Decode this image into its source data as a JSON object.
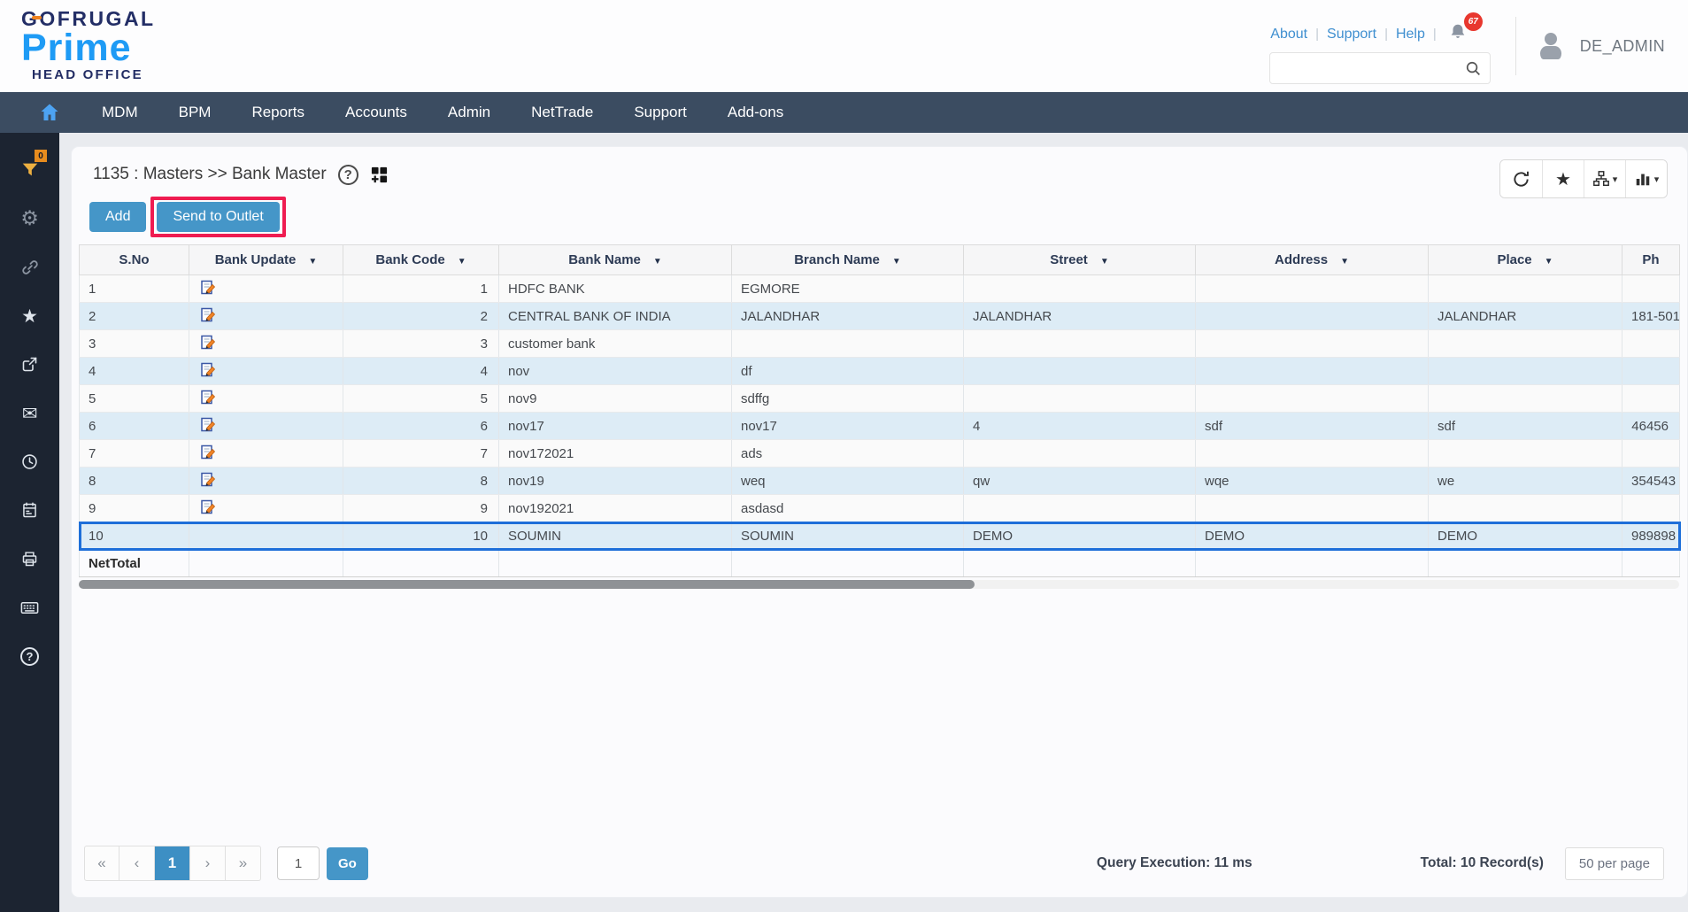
{
  "colors": {
    "accent": "#4596c8",
    "annotation_highlight": "#ef1c51",
    "selected_row_border": "#1e6fd9",
    "navbar_bg": "#3b4c61",
    "sidebar_bg": "#1c2431",
    "row_alt_bg": "#ddecf6",
    "badge_red": "#e8372e"
  },
  "header": {
    "logo": {
      "brand": "GOFRUGAL",
      "product": "Prime",
      "suffix": "HEAD OFFICE"
    },
    "links": [
      "About",
      "Support",
      "Help"
    ],
    "notification_count": "67",
    "search_placeholder": "",
    "user": "DE_ADMIN"
  },
  "navbar": {
    "items": [
      "MDM",
      "BPM",
      "Reports",
      "Accounts",
      "Admin",
      "NetTrade",
      "Support",
      "Add-ons"
    ]
  },
  "sidebar": {
    "filter_badge": "0",
    "icons": [
      "filter-icon",
      "gear-icon",
      "link-icon",
      "star-icon",
      "share-icon",
      "mail-icon",
      "clock-icon",
      "report-icon",
      "print-icon",
      "keyboard-icon",
      "help-icon"
    ]
  },
  "page": {
    "breadcrumb": "1135 : Masters >> Bank Master",
    "add_label": "Add",
    "send_to_outlet_label": "Send to Outlet"
  },
  "table": {
    "columns": [
      {
        "label": "S.No",
        "sortable": false
      },
      {
        "label": "Bank Update",
        "sortable": true
      },
      {
        "label": "Bank Code",
        "sortable": true
      },
      {
        "label": "Bank Name",
        "sortable": true
      },
      {
        "label": "Branch Name",
        "sortable": true
      },
      {
        "label": "Street",
        "sortable": true
      },
      {
        "label": "Address",
        "sortable": true
      },
      {
        "label": "Place",
        "sortable": true
      },
      {
        "label": "Ph",
        "sortable": false
      }
    ],
    "rows": [
      {
        "sno": "1",
        "edit": true,
        "code": "1",
        "name": "HDFC BANK",
        "branch": "EGMORE",
        "street": "",
        "address": "",
        "place": "",
        "phone": "",
        "selected": false
      },
      {
        "sno": "2",
        "edit": true,
        "code": "2",
        "name": "CENTRAL BANK OF INDIA",
        "branch": "JALANDHAR",
        "street": "JALANDHAR",
        "address": "",
        "place": "JALANDHAR",
        "phone": "181-501",
        "selected": false
      },
      {
        "sno": "3",
        "edit": true,
        "code": "3",
        "name": "customer bank",
        "branch": "",
        "street": "",
        "address": "",
        "place": "",
        "phone": "",
        "selected": false
      },
      {
        "sno": "4",
        "edit": true,
        "code": "4",
        "name": "nov",
        "branch": "df",
        "street": "",
        "address": "",
        "place": "",
        "phone": "",
        "selected": false
      },
      {
        "sno": "5",
        "edit": true,
        "code": "5",
        "name": "nov9",
        "branch": "sdffg",
        "street": "",
        "address": "",
        "place": "",
        "phone": "",
        "selected": false
      },
      {
        "sno": "6",
        "edit": true,
        "code": "6",
        "name": "nov17",
        "branch": "nov17",
        "street": "4",
        "address": "sdf",
        "place": "sdf",
        "phone": "46456",
        "selected": false
      },
      {
        "sno": "7",
        "edit": true,
        "code": "7",
        "name": "nov172021",
        "branch": "ads",
        "street": "",
        "address": "",
        "place": "",
        "phone": "",
        "selected": false
      },
      {
        "sno": "8",
        "edit": true,
        "code": "8",
        "name": "nov19",
        "branch": "weq",
        "street": "qw",
        "address": "wqe",
        "place": "we",
        "phone": "354543",
        "selected": false
      },
      {
        "sno": "9",
        "edit": true,
        "code": "9",
        "name": "nov192021",
        "branch": "asdasd",
        "street": "",
        "address": "",
        "place": "",
        "phone": "",
        "selected": false
      },
      {
        "sno": "10",
        "edit": false,
        "code": "10",
        "name": "SOUMIN",
        "branch": "SOUMIN",
        "street": "DEMO",
        "address": "DEMO",
        "place": "DEMO",
        "phone": "989898",
        "selected": true
      }
    ],
    "net_total_label": "NetTotal"
  },
  "pagination": {
    "first": "«",
    "prev": "‹",
    "current_page": "1",
    "next": "›",
    "last": "»",
    "goto_value": "1",
    "go_label": "Go"
  },
  "footer": {
    "query_execution": "Query Execution: 11 ms",
    "total": "Total: 10 Record(s)",
    "per_page": "50 per page"
  }
}
